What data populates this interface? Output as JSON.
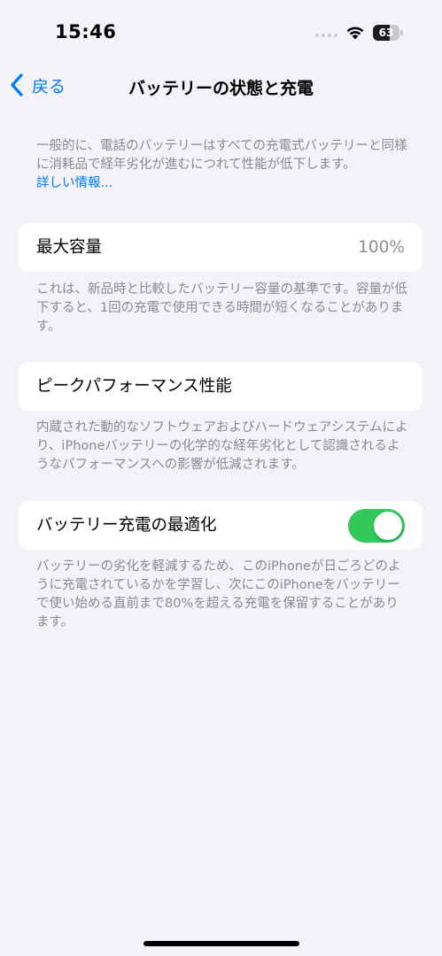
{
  "status_bar": {
    "time": "15:46",
    "battery_percent": "63",
    "battery_level": 0.63
  },
  "nav": {
    "back_label": "戻る",
    "title": "バッテリーの状態と充電"
  },
  "intro": {
    "text": "一般的に、電話のバッテリーはすべての充電式バッテリーと同様に消耗品で経年劣化が進むにつれて性能が低下します。",
    "link": "詳しい情報..."
  },
  "max_capacity": {
    "label": "最大容量",
    "value": "100%",
    "footer": "これは、新品時と比較したバッテリー容量の基準です。容量が低下すると、1回の充電で使用できる時間が短くなることがあります。"
  },
  "peak_performance": {
    "label": "ピークパフォーマンス性能",
    "footer": "内蔵された動的なソフトウェアおよびハードウェアシステムにより、iPhoneバッテリーの化学的な経年劣化として認識されるようなパフォーマンスへの影響が低減されます。"
  },
  "optimized_charging": {
    "label": "バッテリー充電の最適化",
    "enabled": true,
    "footer": "バッテリーの劣化を軽減するため、このiPhoneが日ごろどのように充電されているかを学習し、次にこのiPhoneをバッテリーで使い始める直前まで80%を超える充電を保留することがあります。"
  },
  "colors": {
    "accent": "#007aff",
    "toggle_on": "#34c759",
    "background": "#f2f2f7"
  }
}
